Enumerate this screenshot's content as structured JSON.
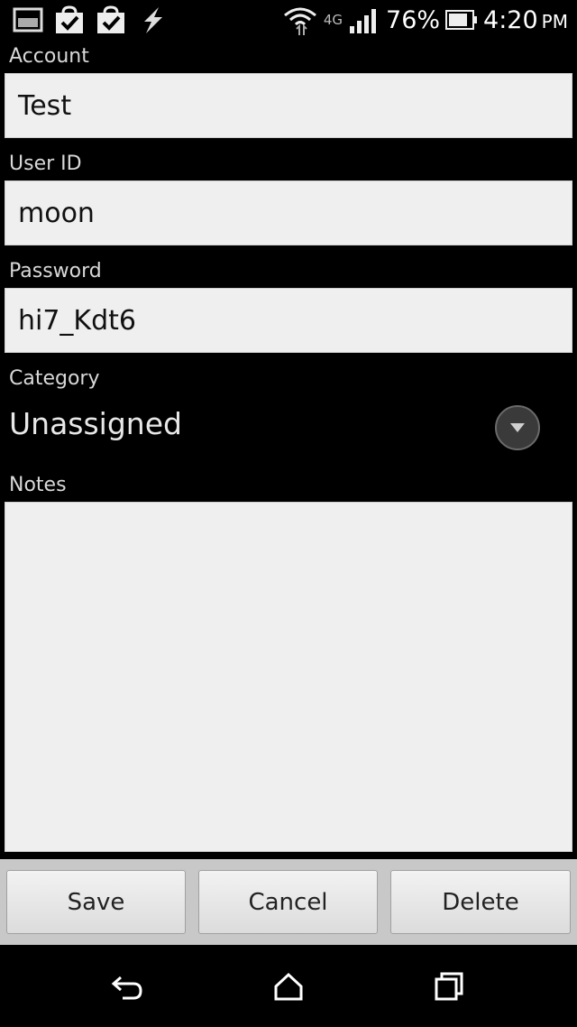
{
  "status_bar": {
    "battery_percent": "76%",
    "network": "4G",
    "time": "4:20",
    "ampm": "PM",
    "icons_left": [
      "image-icon",
      "shopping-bag-check-icon",
      "shopping-bag-check-icon",
      "lightning-icon"
    ],
    "icons_right": [
      "wifi-icon",
      "signal-icon",
      "battery-icon"
    ]
  },
  "form": {
    "account_label": "Account",
    "account_value": "Test",
    "userid_label": "User ID",
    "userid_value": "moon",
    "password_label": "Password",
    "password_value": "hi7_Kdt6",
    "category_label": "Category",
    "category_value": "Unassigned",
    "notes_label": "Notes",
    "notes_value": ""
  },
  "buttons": {
    "save": "Save",
    "cancel": "Cancel",
    "delete": "Delete"
  },
  "nav": [
    "back-icon",
    "home-icon",
    "recent-apps-icon"
  ]
}
